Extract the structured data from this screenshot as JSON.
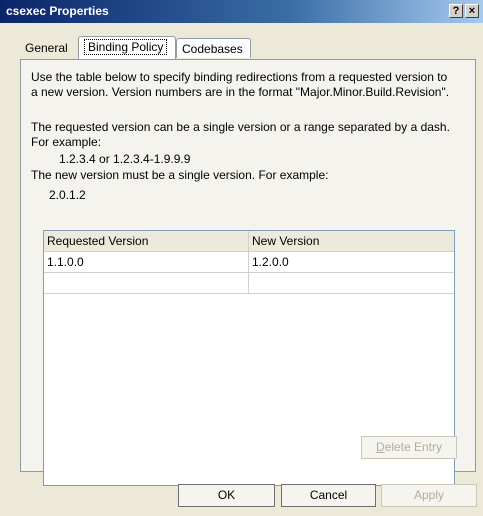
{
  "window": {
    "title": "csexec Properties",
    "help_button": "?",
    "close_button": "×"
  },
  "tabs": [
    {
      "label": "General"
    },
    {
      "label": "Binding Policy"
    },
    {
      "label": "Codebases"
    }
  ],
  "content": {
    "intro": "Use the table below to specify binding redirections from a requested version to a new version.  Version numbers are in the format \"Major.Minor.Build.Revision\".",
    "requested_info": "The requested version can be a single version or a range separated by a dash.  For example:",
    "requested_example": "1.2.3.4 or 1.2.3.4-1.9.9.9",
    "new_info": "The new version must be a single version.  For example:",
    "new_example": "2.0.1.2"
  },
  "table": {
    "columns": [
      "Requested Version",
      "New Version"
    ],
    "rows": [
      [
        "1.1.0.0",
        "1.2.0.0"
      ],
      [
        "",
        ""
      ]
    ]
  },
  "buttons": {
    "delete_entry_first": "D",
    "delete_entry_rest": "elete Entry",
    "ok": "OK",
    "cancel": "Cancel",
    "apply": "Apply"
  },
  "colors": {
    "titlebar_start": "#0a246a",
    "titlebar_end": "#a6caf0",
    "dialog_bg": "#ece9d8",
    "disabled_text": "#b0ada0"
  }
}
